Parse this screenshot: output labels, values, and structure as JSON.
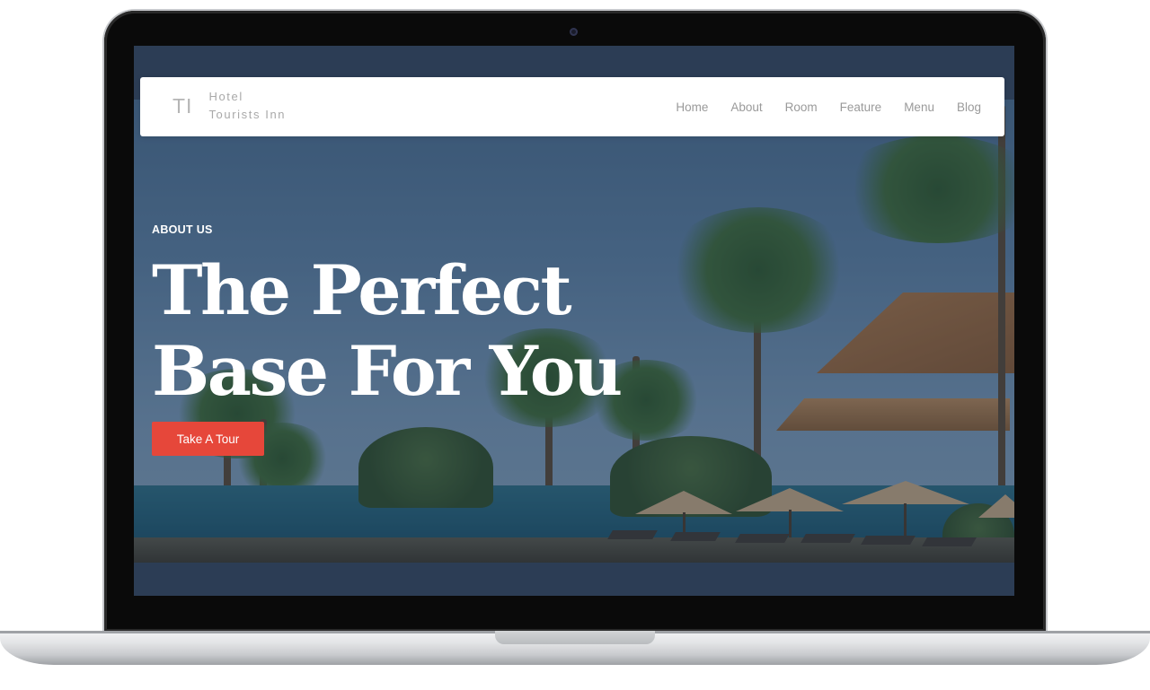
{
  "nav": {
    "brand_mark": "TI",
    "brand_line1": "Hotel",
    "brand_line2": "Tourists Inn",
    "links": [
      "Home",
      "About",
      "Room",
      "Feature",
      "Menu",
      "Blog"
    ]
  },
  "hero": {
    "eyebrow": "ABOUT US",
    "headline_line1": "The Perfect",
    "headline_line2": "Base For You",
    "cta_label": "Take A Tour"
  },
  "colors": {
    "accent": "#e6473a",
    "screen_background": "#2c3d55",
    "nav_text": "#9a9a9a"
  }
}
